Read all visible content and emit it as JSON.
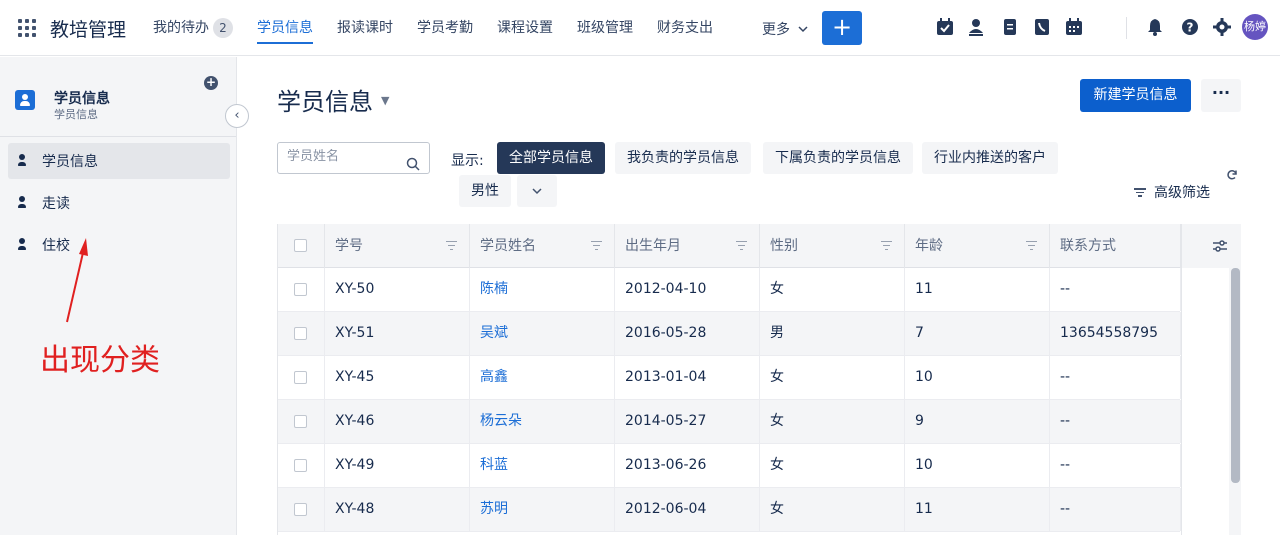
{
  "app": {
    "title": "教培管理"
  },
  "nav": {
    "items": [
      {
        "label": "我的待办",
        "badge": "2"
      },
      {
        "label": "学员信息"
      },
      {
        "label": "报读课时"
      },
      {
        "label": "学员考勤"
      },
      {
        "label": "课程设置"
      },
      {
        "label": "班级管理"
      },
      {
        "label": "财务支出"
      }
    ],
    "more_label": "更多",
    "add_label": "+",
    "user_avatar": "杨婷"
  },
  "sidebar": {
    "header_title": "学员信息",
    "header_subtitle": "学员信息",
    "add_label": "+",
    "items": [
      {
        "label": "学员信息",
        "active": true
      },
      {
        "label": "走读"
      },
      {
        "label": "住校"
      }
    ],
    "annotation": "出现分类"
  },
  "main": {
    "title": "学员信息",
    "new_button": "新建学员信息",
    "more_button": "···",
    "search_placeholder": "学员姓名",
    "show_label": "显示:",
    "filters": [
      "全部学员信息",
      "我负责的学员信息",
      "下属负责的学员信息",
      "行业内推送的客户",
      "男性"
    ],
    "advanced_filter": "高级筛选"
  },
  "table": {
    "columns": [
      "学号",
      "学员姓名",
      "出生年月",
      "性别",
      "年龄",
      "联系方式"
    ],
    "rows": [
      [
        "XY-50",
        "陈楠",
        "2012-04-10",
        "女",
        "11",
        "--"
      ],
      [
        "XY-51",
        "吴斌",
        "2016-05-28",
        "男",
        "7",
        "13654558795"
      ],
      [
        "XY-45",
        "高鑫",
        "2013-01-04",
        "女",
        "10",
        "--"
      ],
      [
        "XY-46",
        "杨云朵",
        "2014-05-27",
        "女",
        "9",
        "--"
      ],
      [
        "XY-49",
        "科蓝",
        "2013-06-26",
        "女",
        "10",
        "--"
      ],
      [
        "XY-48",
        "苏明",
        "2012-06-04",
        "女",
        "11",
        "--"
      ]
    ]
  },
  "colors": {
    "accent": "#1c6ed6",
    "active_chip": "#253858",
    "annotation": "#e02020"
  }
}
